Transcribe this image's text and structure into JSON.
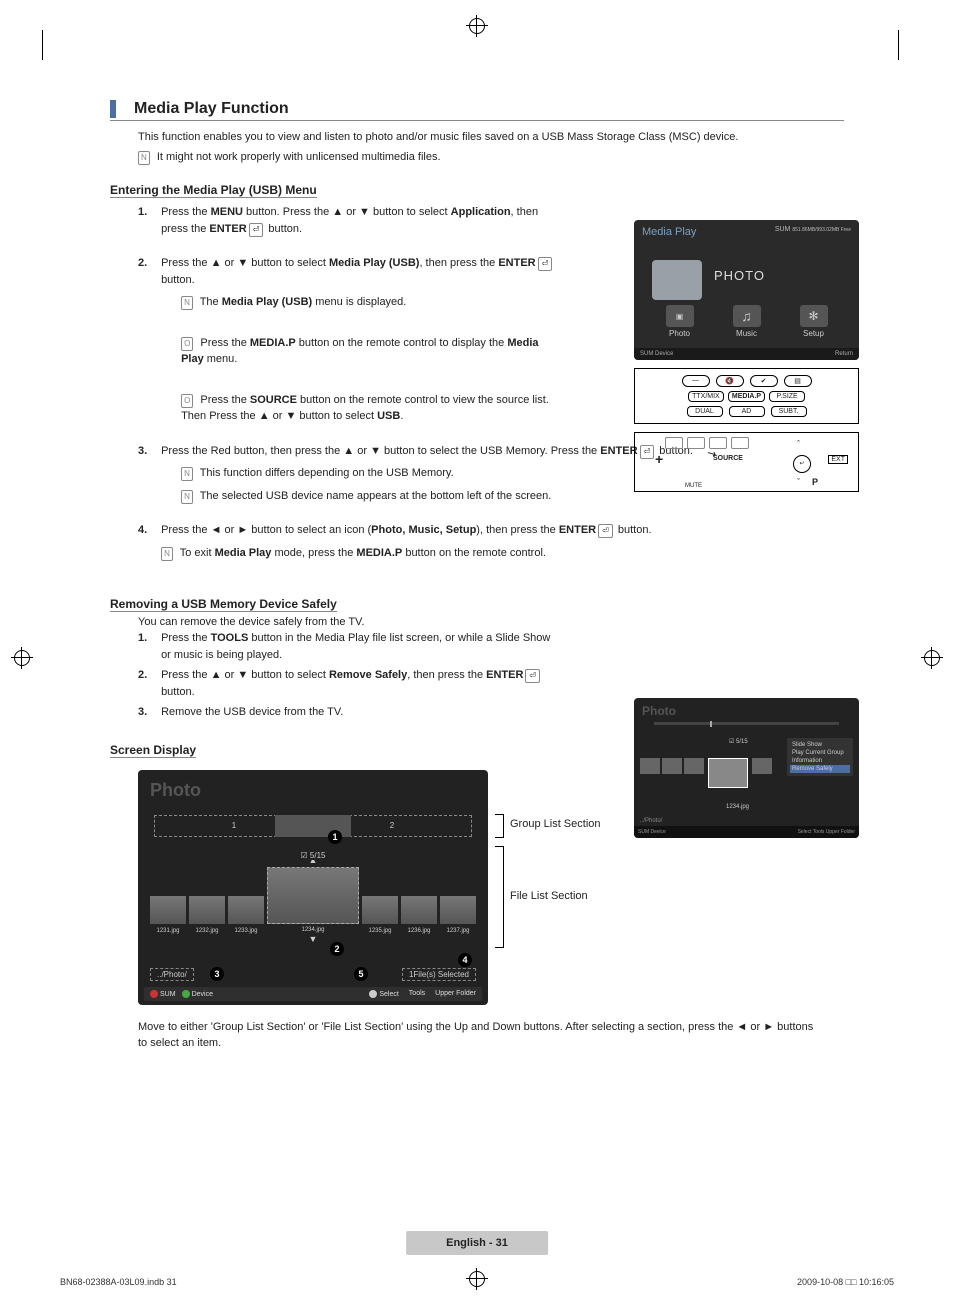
{
  "title": "Media Play Function",
  "intro": "This function enables you to view and listen to photo and/or music files saved on a USB Mass Storage Class (MSC) device.",
  "intro_note": "It might not work properly with unlicensed multimedia files.",
  "section1": {
    "heading": "Entering the Media Play (USB) Menu",
    "step1_num": "1.",
    "step1_a": "Press the ",
    "step1_menu": "MENU",
    "step1_b": " button. Press the ▲ or ▼ button to select ",
    "step1_app": "Application",
    "step1_c": ", then press the ",
    "step1_enter": "ENTER",
    "step1_d": " button.",
    "step2_num": "2.",
    "step2_a": "Press the ▲ or ▼ button to select ",
    "step2_mp": "Media Play (USB)",
    "step2_b": ", then press the ",
    "step2_enter": "ENTER",
    "step2_c": " button.",
    "step2_note1_a": "The ",
    "step2_note1_b": "Media Play (USB)",
    "step2_note1_c": " menu is displayed.",
    "step2_note2_a": "Press the ",
    "step2_note2_b": "MEDIA.P",
    "step2_note2_c": " button on the remote control to display the ",
    "step2_note2_d": "Media Play",
    "step2_note2_e": " menu.",
    "step2_note3_a": "Press the ",
    "step2_note3_b": "SOURCE",
    "step2_note3_c": " button on the remote control to view the source list. Then Press the ▲ or ▼ button to select ",
    "step2_note3_d": "USB",
    "step2_note3_e": ".",
    "step3_num": "3.",
    "step3_a": "Press the Red button, then press the ▲ or ▼ button to select the USB Memory. Press the ",
    "step3_enter": "ENTER",
    "step3_b": " button.",
    "step3_note1": "This function differs depending on the USB Memory.",
    "step3_note2": "The selected USB device name appears at the bottom left of the screen.",
    "step4_num": "4.",
    "step4_a": "Press the ◄ or ► button to select an icon (",
    "step4_b": "Photo, Music, Setup",
    "step4_c": "), then press the ",
    "step4_enter": "ENTER",
    "step4_d": " button.",
    "step4_note_a": "To exit ",
    "step4_note_b": "Media Play",
    "step4_note_c": " mode, press the ",
    "step4_note_d": "MEDIA.P",
    "step4_note_e": " button on the remote control."
  },
  "tv1": {
    "title": "Media Play",
    "sum": "SUM",
    "sumdev": "851.86MB/993.02MB Free",
    "photo_big": "PHOTO",
    "photo": "Photo",
    "music": "Music",
    "setup": "Setup",
    "foot_l": "SUM    Device",
    "foot_r": "Return"
  },
  "remote1": {
    "b1": "—",
    "b2": "🔇",
    "b3": "✔",
    "b4": "▤",
    "b5": "TTX/MIX",
    "b6": "MEDIA.P",
    "b7": "P.SIZE",
    "b8": "DUAL",
    "b9": "AD",
    "b10": "SUBT."
  },
  "remote2": {
    "source": "SOURCE",
    "ext": "EXT",
    "p": "P",
    "center": "↵",
    "mute": "MUTE"
  },
  "section2": {
    "heading": "Removing a USB Memory Device Safely",
    "intro": "You can remove the device safely from the TV.",
    "s1_num": "1.",
    "s1_a": "Press the ",
    "s1_b": "TOOLS",
    "s1_c": " button in the Media Play file list screen, or while a Slide Show or music is being played.",
    "s2_num": "2.",
    "s2_a": "Press the ▲ or ▼ button to select ",
    "s2_b": "Remove Safely",
    "s2_c": ", then press the ",
    "s2_enter": "ENTER",
    "s2_d": " button.",
    "s3_num": "3.",
    "s3": "Remove the USB device from the TV."
  },
  "tv2": {
    "title": "Photo",
    "counter": "5/15",
    "tool1": "Slide Show",
    "tool2": "Play Current Group",
    "tool3": "Information",
    "tool4": "Remove Safely",
    "name": "1234.jpg",
    "path": "../Photo/",
    "foot_l": "SUM    Device",
    "foot_r": "Select    Tools    Upper Folder"
  },
  "section3": {
    "heading": "Screen Display"
  },
  "sd": {
    "title": "Photo",
    "g1": "1",
    "g2": "2",
    "counter": "5/15",
    "t1": "1231.jpg",
    "t2": "1232.jpg",
    "t3": "1233.jpg",
    "t4": "1234.jpg",
    "t5": "1235.jpg",
    "t6": "1236.jpg",
    "t7": "1237.jpg",
    "path": "../Photo/",
    "selected": "1File(s) Selected",
    "sum": "SUM",
    "device": "Device",
    "select": "Select",
    "tools": "Tools",
    "upper": "Upper Folder",
    "label_group": "Group List Section",
    "label_file": "File List Section",
    "c1": "1",
    "c2": "2",
    "c3": "3",
    "c4": "4",
    "c5": "5"
  },
  "foot_para": "Move to either 'Group List Section' or 'File List Section' using the Up and Down buttons. After selecting a section, press the ◄ or ► buttons to select an item.",
  "page_num": "English - 31",
  "doc_l": "BN68-02388A-03L09.indb   31",
  "doc_r": "2009-10-08   □□ 10:16:05"
}
